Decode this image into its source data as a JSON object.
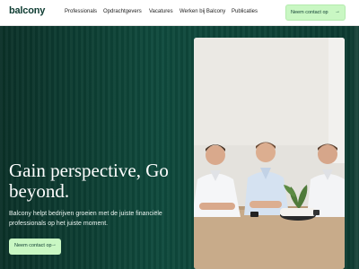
{
  "header": {
    "logo": "balcony",
    "nav": [
      "Professionals",
      "Opdrachtgevers",
      "Vacatures",
      "Werken bij Balcony",
      "Publicaties"
    ],
    "cta_label": "Neem contact op"
  },
  "hero": {
    "headline_line1": "Gain perspective, Go",
    "headline_line2": "beyond.",
    "subtext_line1": "Balcony helpt bedrijven groeien met de juiste financiële",
    "subtext_line2": "professionals op het juiste moment.",
    "cta_label": "Neem contact op",
    "photo_description": "three-men-smiling-photo"
  },
  "colors": {
    "brand_green": "#0e3c32",
    "cta_green": "#c9f7c3"
  }
}
